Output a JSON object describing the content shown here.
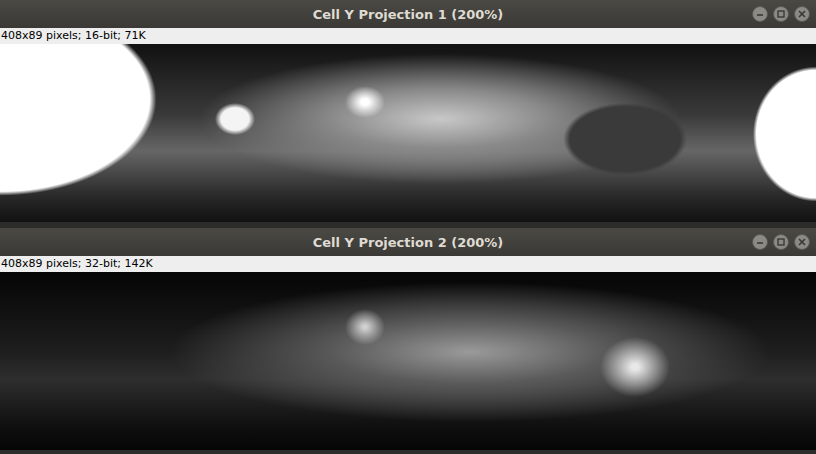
{
  "windows": [
    {
      "title": "Cell Y Projection 1 (200%)",
      "info": "408x89 pixels; 16-bit; 71K",
      "kind": "saturated"
    },
    {
      "title": "Cell Y Projection 2 (200%)",
      "info": "408x89 pixels; 32-bit; 142K",
      "kind": "smooth"
    }
  ]
}
